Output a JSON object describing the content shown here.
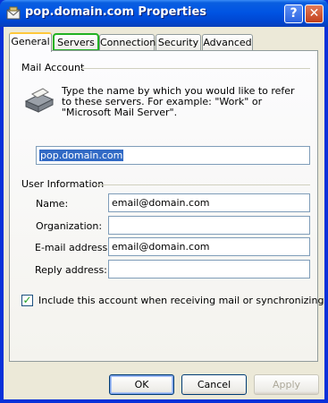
{
  "window": {
    "title": "pop.domain.com Properties"
  },
  "titlebar": {
    "help": "?",
    "close": "✕"
  },
  "tabs": [
    {
      "label": "General"
    },
    {
      "label": "Servers"
    },
    {
      "label": "Connection"
    },
    {
      "label": "Security"
    },
    {
      "label": "Advanced"
    }
  ],
  "mail_account": {
    "heading": "Mail Account",
    "description": "Type the name by which you would like to refer to these servers.  For example: \"Work\" or \"Microsoft Mail Server\".",
    "account_name": "pop.domain.com"
  },
  "user_info": {
    "heading": "User Information",
    "name_label": "Name:",
    "name_value": "email@domain.com",
    "org_label": "Organization:",
    "org_value": "",
    "email_label": "E-mail address:",
    "email_value": "email@domain.com",
    "reply_label": "Reply address:",
    "reply_value": ""
  },
  "include_checkbox": {
    "label": "Include this account when receiving mail or synchronizing",
    "checked": true
  },
  "buttons": {
    "ok": "OK",
    "cancel": "Cancel",
    "apply": "Apply"
  }
}
